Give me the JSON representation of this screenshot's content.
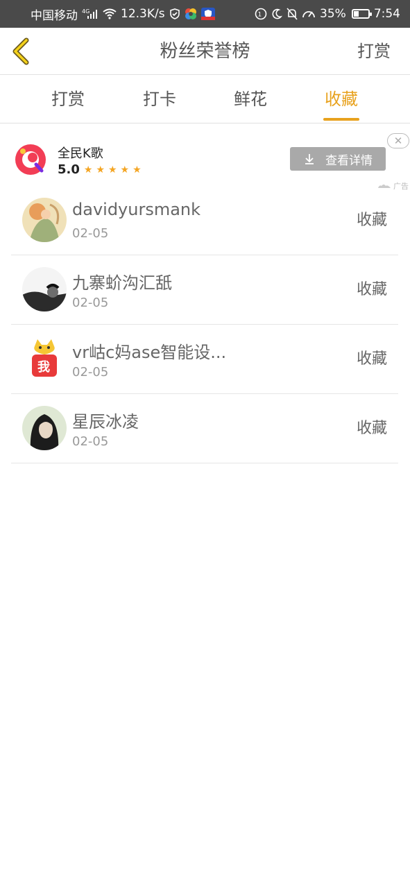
{
  "status_bar": {
    "carrier": "中国移动",
    "network": "4G",
    "speed": "12.3K/s",
    "battery": "35%",
    "battery_level": 0.35,
    "time": "7:54"
  },
  "header": {
    "title": "粉丝荣誉榜",
    "right_action": "打赏",
    "back_icon": "chevron-left-icon",
    "accent_color": "#e8a21e"
  },
  "tabs": [
    {
      "label": "打赏",
      "active": false
    },
    {
      "label": "打卡",
      "active": false
    },
    {
      "label": "鲜花",
      "active": false
    },
    {
      "label": "收藏",
      "active": true
    }
  ],
  "ad": {
    "app_name": "全民K歌",
    "rating": "5.0",
    "stars": 5,
    "button_label": "查看详情",
    "tag": "广告"
  },
  "list": [
    {
      "name": "davidyursmank",
      "date": "02-05",
      "action": "收藏"
    },
    {
      "name": "九寨蚧沟汇舐",
      "date": "02-05",
      "action": "收藏"
    },
    {
      "name": "vr岵c妈ase智能设...",
      "date": "02-05",
      "action": "收藏"
    },
    {
      "name": "星辰冰凌",
      "date": "02-05",
      "action": "收藏"
    }
  ]
}
